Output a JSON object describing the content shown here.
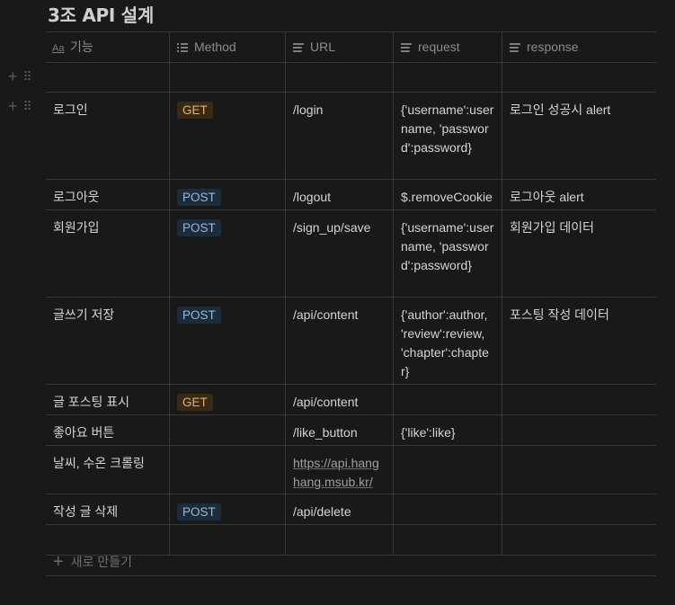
{
  "page": {
    "title": "3조 API 설계"
  },
  "table": {
    "columns": [
      {
        "label": "기능",
        "icon": "title-property-icon"
      },
      {
        "label": "Method",
        "icon": "select-property-icon"
      },
      {
        "label": "URL",
        "icon": "text-property-icon"
      },
      {
        "label": "request",
        "icon": "text-property-icon"
      },
      {
        "label": "response",
        "icon": "text-property-icon"
      }
    ],
    "rows": [
      {
        "feature": "",
        "method": "",
        "url": "",
        "request": "",
        "response": ""
      },
      {
        "feature": "로그인",
        "method": "GET",
        "url": "/login",
        "request": "{'username':username, 'password':password}",
        "response": "로그인 성공시 alert"
      },
      {
        "feature": "로그아웃",
        "method": "POST",
        "url": "/logout",
        "request": "$.removeCookie",
        "response": "로그아웃 alert"
      },
      {
        "feature": "회원가입",
        "method": "POST",
        "url": "/sign_up/save",
        "request": "{'username':username, 'password':password}",
        "response": "회원가입 데이터"
      },
      {
        "feature": "글쓰기 저장",
        "method": "POST",
        "url": "/api/content",
        "request": "{'author':author, 'review':review, 'chapter':chapter}",
        "response": "포스팅 작성 데이터"
      },
      {
        "feature": "글 포스팅 표시",
        "method": "GET",
        "url": "/api/content",
        "request": "",
        "response": ""
      },
      {
        "feature": "좋아요 버튼",
        "method": "",
        "url": "/like_button",
        "request": "{'like':like}",
        "response": ""
      },
      {
        "feature": "날씨, 수온 크롤링",
        "method": "",
        "url": "https://api.hanghang.msub.kr/",
        "request": "",
        "response": ""
      },
      {
        "feature": "작성 글 삭제",
        "method": "POST",
        "url": "/api/delete",
        "request": "",
        "response": ""
      },
      {
        "feature": "",
        "method": "",
        "url": "",
        "request": "",
        "response": ""
      }
    ],
    "new_row_label": "새로 만들기"
  },
  "colors": {
    "get_badge": "#3b2a13",
    "post_badge": "#1d2c3a",
    "background": "#191919"
  }
}
